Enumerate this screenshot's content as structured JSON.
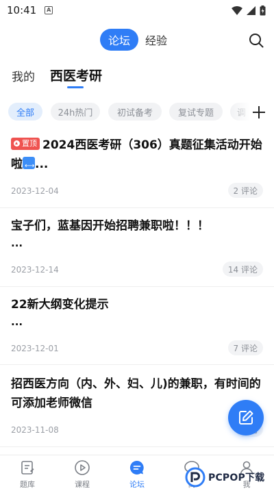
{
  "status_bar": {
    "time": "10:41",
    "notification_glyph": "A"
  },
  "header": {
    "segment_active": "论坛",
    "segment_inactive": "经验",
    "search_icon": "search-icon"
  },
  "sub_tabs": {
    "mine": "我的",
    "active": "西医考研"
  },
  "chips": [
    "全部",
    "24h热门",
    "初试备考",
    "复试专题",
    "调"
  ],
  "posts": [
    {
      "pin": "置顶",
      "title": "2024西医考研（306）真题征集活动开始啦",
      "tail": "...",
      "date": "2023-12-04",
      "comments": "2 评论"
    },
    {
      "title": "宝子们，蓝基因开始招聘兼职啦！！！",
      "tail": "...",
      "date": "2023-12-14",
      "comments": "14 评论"
    },
    {
      "title": "22新大纲变化提示",
      "tail": "...",
      "date": "2023-12-01",
      "comments": "7 评论"
    },
    {
      "title": "招西医方向（内、外、妇、儿)的兼职，有时间的可添加老师微信",
      "date": "2023-11-08",
      "comments": "评论"
    }
  ],
  "bottom_nav": [
    {
      "label": "题库",
      "icon": "question-bank-icon"
    },
    {
      "label": "课程",
      "icon": "play-circle-icon"
    },
    {
      "label": "论坛",
      "icon": "chat-bubble-icon"
    },
    {
      "label": "商",
      "icon": "message-icon"
    },
    {
      "label": "我",
      "icon": "person-icon"
    }
  ],
  "watermark": {
    "text": "PCPOP下载"
  },
  "colors": {
    "accent": "#2f7df6",
    "pin_red": "#ef5350",
    "muted": "#9a9ea5"
  }
}
